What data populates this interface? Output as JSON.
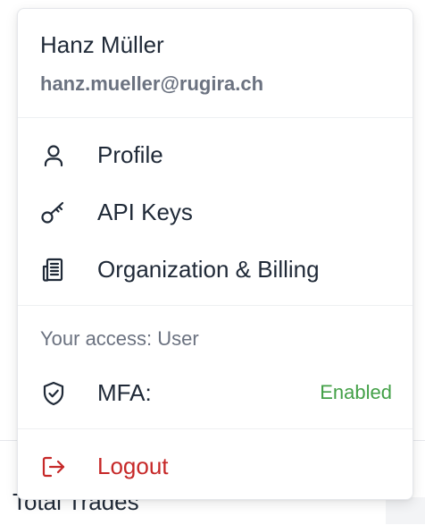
{
  "background": {
    "card_title": "Total Trades"
  },
  "user": {
    "name": "Hanz Müller",
    "email": "hanz.mueller@rugira.ch"
  },
  "menu": {
    "items": [
      {
        "label": "Profile",
        "icon": "user-icon"
      },
      {
        "label": "API Keys",
        "icon": "key-icon"
      },
      {
        "label": "Organization & Billing",
        "icon": "receipt-icon"
      }
    ],
    "access_text": "Your access: User",
    "mfa": {
      "label": "MFA:",
      "status": "Enabled",
      "icon": "shield-check-icon",
      "status_color": "#43a047"
    },
    "logout": {
      "label": "Logout",
      "icon": "logout-icon",
      "color": "#c62828"
    }
  }
}
